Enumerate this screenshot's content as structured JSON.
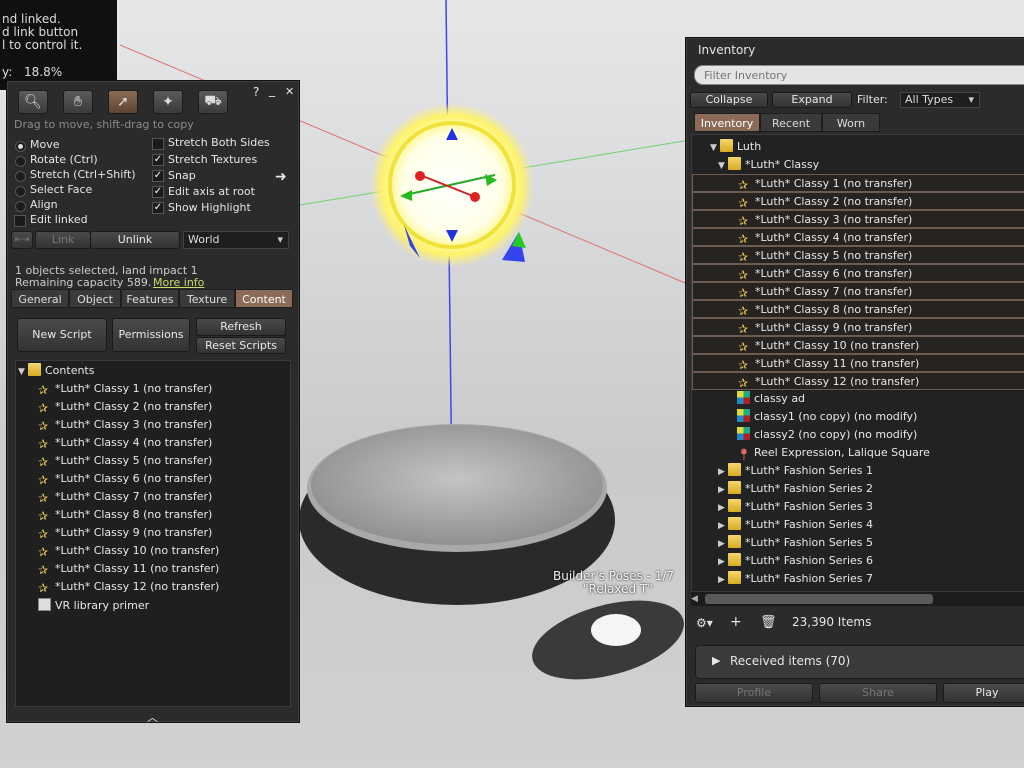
{
  "hud": {
    "line1": "nd linked.",
    "line2": "d link button",
    "line3": "l to control it.",
    "line4_label": "y:",
    "line4_value": "18.8%"
  },
  "scene": {
    "avatar_title": "Builder's Poses - 1/7",
    "avatar_subtitle": "\"Relaxed T\""
  },
  "build": {
    "hint": "Drag to move, shift-drag to copy",
    "help": "?",
    "minimize": "_",
    "close": "✕",
    "modes": [
      {
        "label": "Move",
        "selected": true
      },
      {
        "label": "Rotate (Ctrl)",
        "selected": false
      },
      {
        "label": "Stretch (Ctrl+Shift)",
        "selected": false
      },
      {
        "label": "Select Face",
        "selected": false
      },
      {
        "label": "Align",
        "selected": false
      }
    ],
    "edit_linked": "Edit linked",
    "options": [
      {
        "label": "Stretch Both Sides",
        "checked": false
      },
      {
        "label": "Stretch Textures",
        "checked": true
      },
      {
        "label": "Snap",
        "checked": true
      },
      {
        "label": "Edit axis at root",
        "checked": true
      },
      {
        "label": "Show Highlight",
        "checked": true
      }
    ],
    "link_label": "Link",
    "unlink_label": "Unlink",
    "ruler_value": "World",
    "selected_info": "1 objects selected, land impact 1",
    "remaining_text": "Remaining capacity 589.",
    "more_info": "More info",
    "tabs": [
      "General",
      "Object",
      "Features",
      "Texture",
      "Content"
    ],
    "new_script": "New Script",
    "permissions": "Permissions",
    "refresh": "Refresh",
    "reset_scripts": "Reset Scripts",
    "contents_folder": "Contents",
    "items": [
      "*Luth* Classy 1 (no transfer)",
      "*Luth* Classy 2 (no transfer)",
      "*Luth* Classy 3 (no transfer)",
      "*Luth* Classy 4 (no transfer)",
      "*Luth* Classy 5 (no transfer)",
      "*Luth* Classy 6 (no transfer)",
      "*Luth* Classy 7 (no transfer)",
      "*Luth* Classy 8 (no transfer)",
      "*Luth* Classy 9 (no transfer)",
      "*Luth* Classy 10 (no transfer)",
      "*Luth* Classy 11 (no transfer)",
      "*Luth* Classy 12 (no transfer)"
    ],
    "notecard": "VR library primer"
  },
  "inventory": {
    "title": "Inventory",
    "filter_placeholder": "Filter Inventory",
    "collapse": "Collapse",
    "expand": "Expand",
    "filter_label": "Filter:",
    "filter_value": "All Types",
    "tabs": [
      "Inventory",
      "Recent",
      "Worn"
    ],
    "folder_luth": "Luth",
    "folder_classy": "*Luth* Classy",
    "items": [
      "*Luth* Classy 1 (no transfer)",
      "*Luth* Classy 2 (no transfer)",
      "*Luth* Classy 3 (no transfer)",
      "*Luth* Classy 4 (no transfer)",
      "*Luth* Classy 5 (no transfer)",
      "*Luth* Classy 6 (no transfer)",
      "*Luth* Classy 7 (no transfer)",
      "*Luth* Classy 8 (no transfer)",
      "*Luth* Classy 9 (no transfer)",
      "*Luth* Classy 10 (no transfer)",
      "*Luth* Classy 11 (no transfer)",
      "*Luth* Classy 12 (no transfer)"
    ],
    "textures": [
      "classy ad",
      "classy1 (no copy) (no modify)",
      "classy2 (no copy) (no modify)"
    ],
    "landmark": "Reel Expression, Lalique Square",
    "series": [
      "*Luth* Fashion Series 1",
      "*Luth* Fashion Series 2",
      "*Luth* Fashion Series 3",
      "*Luth* Fashion Series 4",
      "*Luth* Fashion Series 5",
      "*Luth* Fashion Series 6",
      "*Luth* Fashion Series 7"
    ],
    "item_count": "23,390 Items",
    "received": "Received items (70)",
    "profile": "Profile",
    "share": "Share",
    "play": "Play"
  }
}
